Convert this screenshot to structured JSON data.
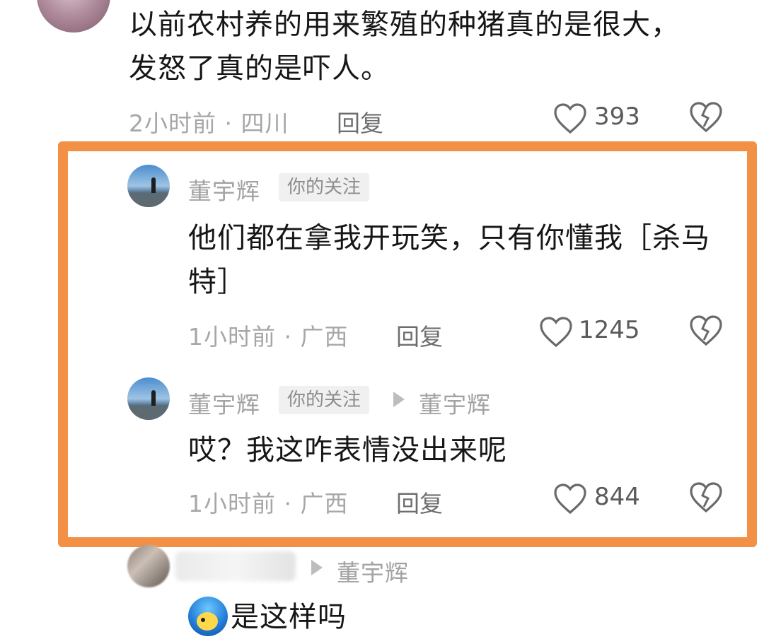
{
  "thread": {
    "top_comment": {
      "text": "以前农村养的用来繁殖的种猪真的是很大，发怒了真的是吓人。",
      "meta": "2小时前 · 四川",
      "reply_label": "回复",
      "likes": "393"
    },
    "replies": [
      {
        "username": "董宇辉",
        "tag": "你的关注",
        "text": "他们都在拿我开玩笑，只有你懂我［杀马特］",
        "meta": "1小时前 · 广西",
        "reply_label": "回复",
        "likes": "1245"
      },
      {
        "username": "董宇辉",
        "tag": "你的关注",
        "reply_to": "董宇辉",
        "text": "哎？我这咋表情没出来呢",
        "meta": "1小时前 · 广西",
        "reply_label": "回复",
        "likes": "844"
      }
    ],
    "next_reply": {
      "reply_to": "董宇辉",
      "text": "是这样吗"
    }
  },
  "colors": {
    "highlight_border": "#f29045",
    "meta_text": "#a7a7a7",
    "follow_tag_bg": "#f0f0f0"
  },
  "icons": {
    "like": "heart-outline-icon",
    "dislike": "broken-heart-icon",
    "reply_arrow": "triangle-right-icon",
    "emoji": "cartoon-face-emoji-icon"
  }
}
